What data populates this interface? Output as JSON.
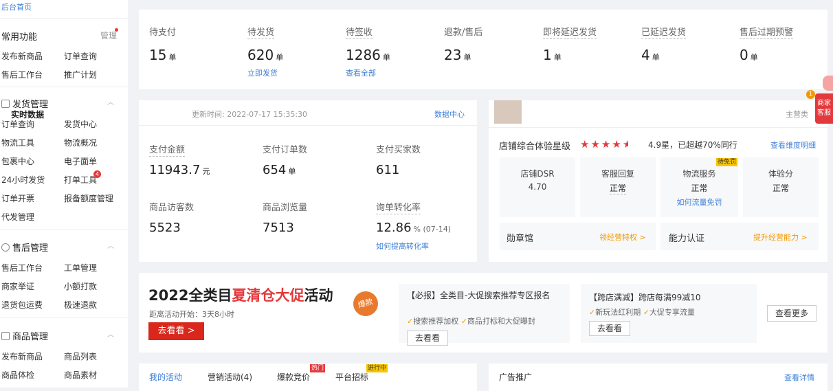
{
  "sidebar": {
    "home_link": "后台首页",
    "common": {
      "title": "常用功能",
      "manage": "管理",
      "items": [
        "发布新商品",
        "订单查询",
        "售后工作台",
        "推广计划"
      ]
    },
    "shipping": {
      "title": "发货管理",
      "items": [
        "订单查询",
        "发货中心",
        "物流工具",
        "物流概况",
        "包裹中心",
        "电子面单",
        "24小时发货",
        "打单工具",
        "订单开票",
        "报备额度管理",
        "代发管理"
      ],
      "badge": "4"
    },
    "aftersale": {
      "title": "售后管理",
      "items": [
        "售后工作台",
        "工单管理",
        "商家举证",
        "小额打款",
        "退货包运费",
        "极速退款"
      ]
    },
    "goods": {
      "title": "商品管理",
      "items": [
        "发布新商品",
        "商品列表",
        "商品体检",
        "商品素材"
      ]
    }
  },
  "orders": [
    {
      "label": "待支付",
      "value": "15",
      "unit": "单",
      "link": ""
    },
    {
      "label": "待发货",
      "value": "620",
      "unit": "单",
      "link": "立即发货"
    },
    {
      "label": "待签收",
      "value": "1286",
      "unit": "单",
      "link": "查看全部"
    },
    {
      "label": "退款/售后",
      "value": "23",
      "unit": "单",
      "link": ""
    },
    {
      "label": "即将延迟发货",
      "value": "1",
      "unit": "单",
      "link": ""
    },
    {
      "label": "已延迟发货",
      "value": "4",
      "unit": "单",
      "link": ""
    },
    {
      "label": "售后过期预警",
      "value": "0",
      "unit": "单",
      "link": ""
    }
  ],
  "realtime": {
    "title": "实时数据",
    "updated": "更新时间: 2022-07-17 15:35:30",
    "center": "数据中心",
    "metrics": [
      {
        "label": "支付金额",
        "value": "11943.7",
        "unit": "元"
      },
      {
        "label": "支付订单数",
        "value": "654",
        "unit": "单"
      },
      {
        "label": "支付买家数",
        "value": "611",
        "unit": ""
      },
      {
        "label": "商品访客数",
        "value": "5523",
        "unit": ""
      },
      {
        "label": "商品浏览量",
        "value": "7513",
        "unit": ""
      },
      {
        "label": "询单转化率",
        "value": "12.86",
        "unit": "% (07-14)"
      }
    ],
    "conv_link": "如何提高转化率"
  },
  "store": {
    "main_category": "主营类",
    "exp_label": "店铺综合体验星级",
    "rating": "4.9星，已超越70%同行",
    "rating_value": 4.5,
    "detail_link": "查看维度明细",
    "cells": [
      {
        "label": "店铺DSR",
        "value": "4.70",
        "tag": "",
        "link": ""
      },
      {
        "label": "客服回复",
        "value": "正常",
        "tag": "",
        "link": ""
      },
      {
        "label": "物流服务",
        "value": "正常",
        "tag": "待免罚",
        "link": "如何流量免罚"
      },
      {
        "label": "体验分",
        "value": "正常",
        "tag": "",
        "link": ""
      }
    ],
    "medal": "勋章馆",
    "medal_link": "领经营特权 >",
    "ability": "能力认证",
    "ability_link": "提升经营能力 >"
  },
  "float_widget": {
    "badge": "1",
    "text1": "商家",
    "text2": "客服"
  },
  "promo": {
    "title_a": "2022全类目",
    "title_b": "夏清仓大促",
    "title_c": "活动",
    "boom": "爆款",
    "countdown": "距离活动开始：3天8小时",
    "go": "去看看 >",
    "card1": {
      "title": "【必报】全类目-大促搜索推荐专区报名",
      "pts": [
        "搜索推荐加权",
        "商品打标和大促曝封"
      ],
      "btn": "去看看"
    },
    "card2": {
      "title": "【跨店满减】跨店每满99减10",
      "pts": [
        "新玩法红利期",
        "大促专享流量"
      ],
      "btn": "去看看"
    },
    "more": "查看更多"
  },
  "activity": {
    "tabs": [
      "我的活动",
      "营销活动(4)",
      "爆款竞价",
      "平台招标"
    ],
    "hot": "热门",
    "ongoing": "进行中"
  },
  "ads": {
    "title": "广告推广",
    "link": "查看详情"
  },
  "colors": {
    "accent": "#3d7fd8",
    "red": "#e4393c",
    "orange": "#f39800"
  }
}
